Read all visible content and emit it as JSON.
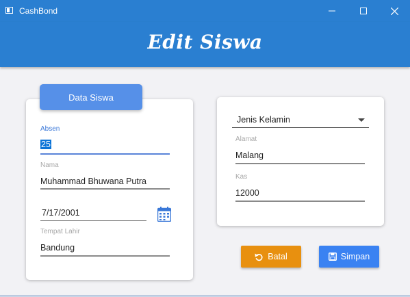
{
  "window": {
    "title": "CashBond"
  },
  "header": {
    "title": "Edit Siswa"
  },
  "left_card": {
    "tab_label": "Data Siswa",
    "absen": {
      "label": "Absen",
      "value": "25"
    },
    "nama": {
      "label": "Nama",
      "value": "Muhammad Bhuwana Putra"
    },
    "tanggal": {
      "value": "7/17/2001"
    },
    "tempat_lahir": {
      "label": "Tempat Lahir",
      "value": "Bandung"
    }
  },
  "right_card": {
    "jenis_kelamin": {
      "value": "Jenis Kelamin"
    },
    "alamat": {
      "label": "Alamat",
      "value": "Malang"
    },
    "kas": {
      "label": "Kas",
      "value": "12000"
    }
  },
  "buttons": {
    "batal": {
      "label": "Batal",
      "icon": "undo-icon",
      "color": "#e8900f"
    },
    "simpan": {
      "label": "Simpan",
      "icon": "save-icon",
      "color": "#3a82f2"
    }
  },
  "colors": {
    "header": "#2a7fd1",
    "accent": "#5690e8"
  }
}
